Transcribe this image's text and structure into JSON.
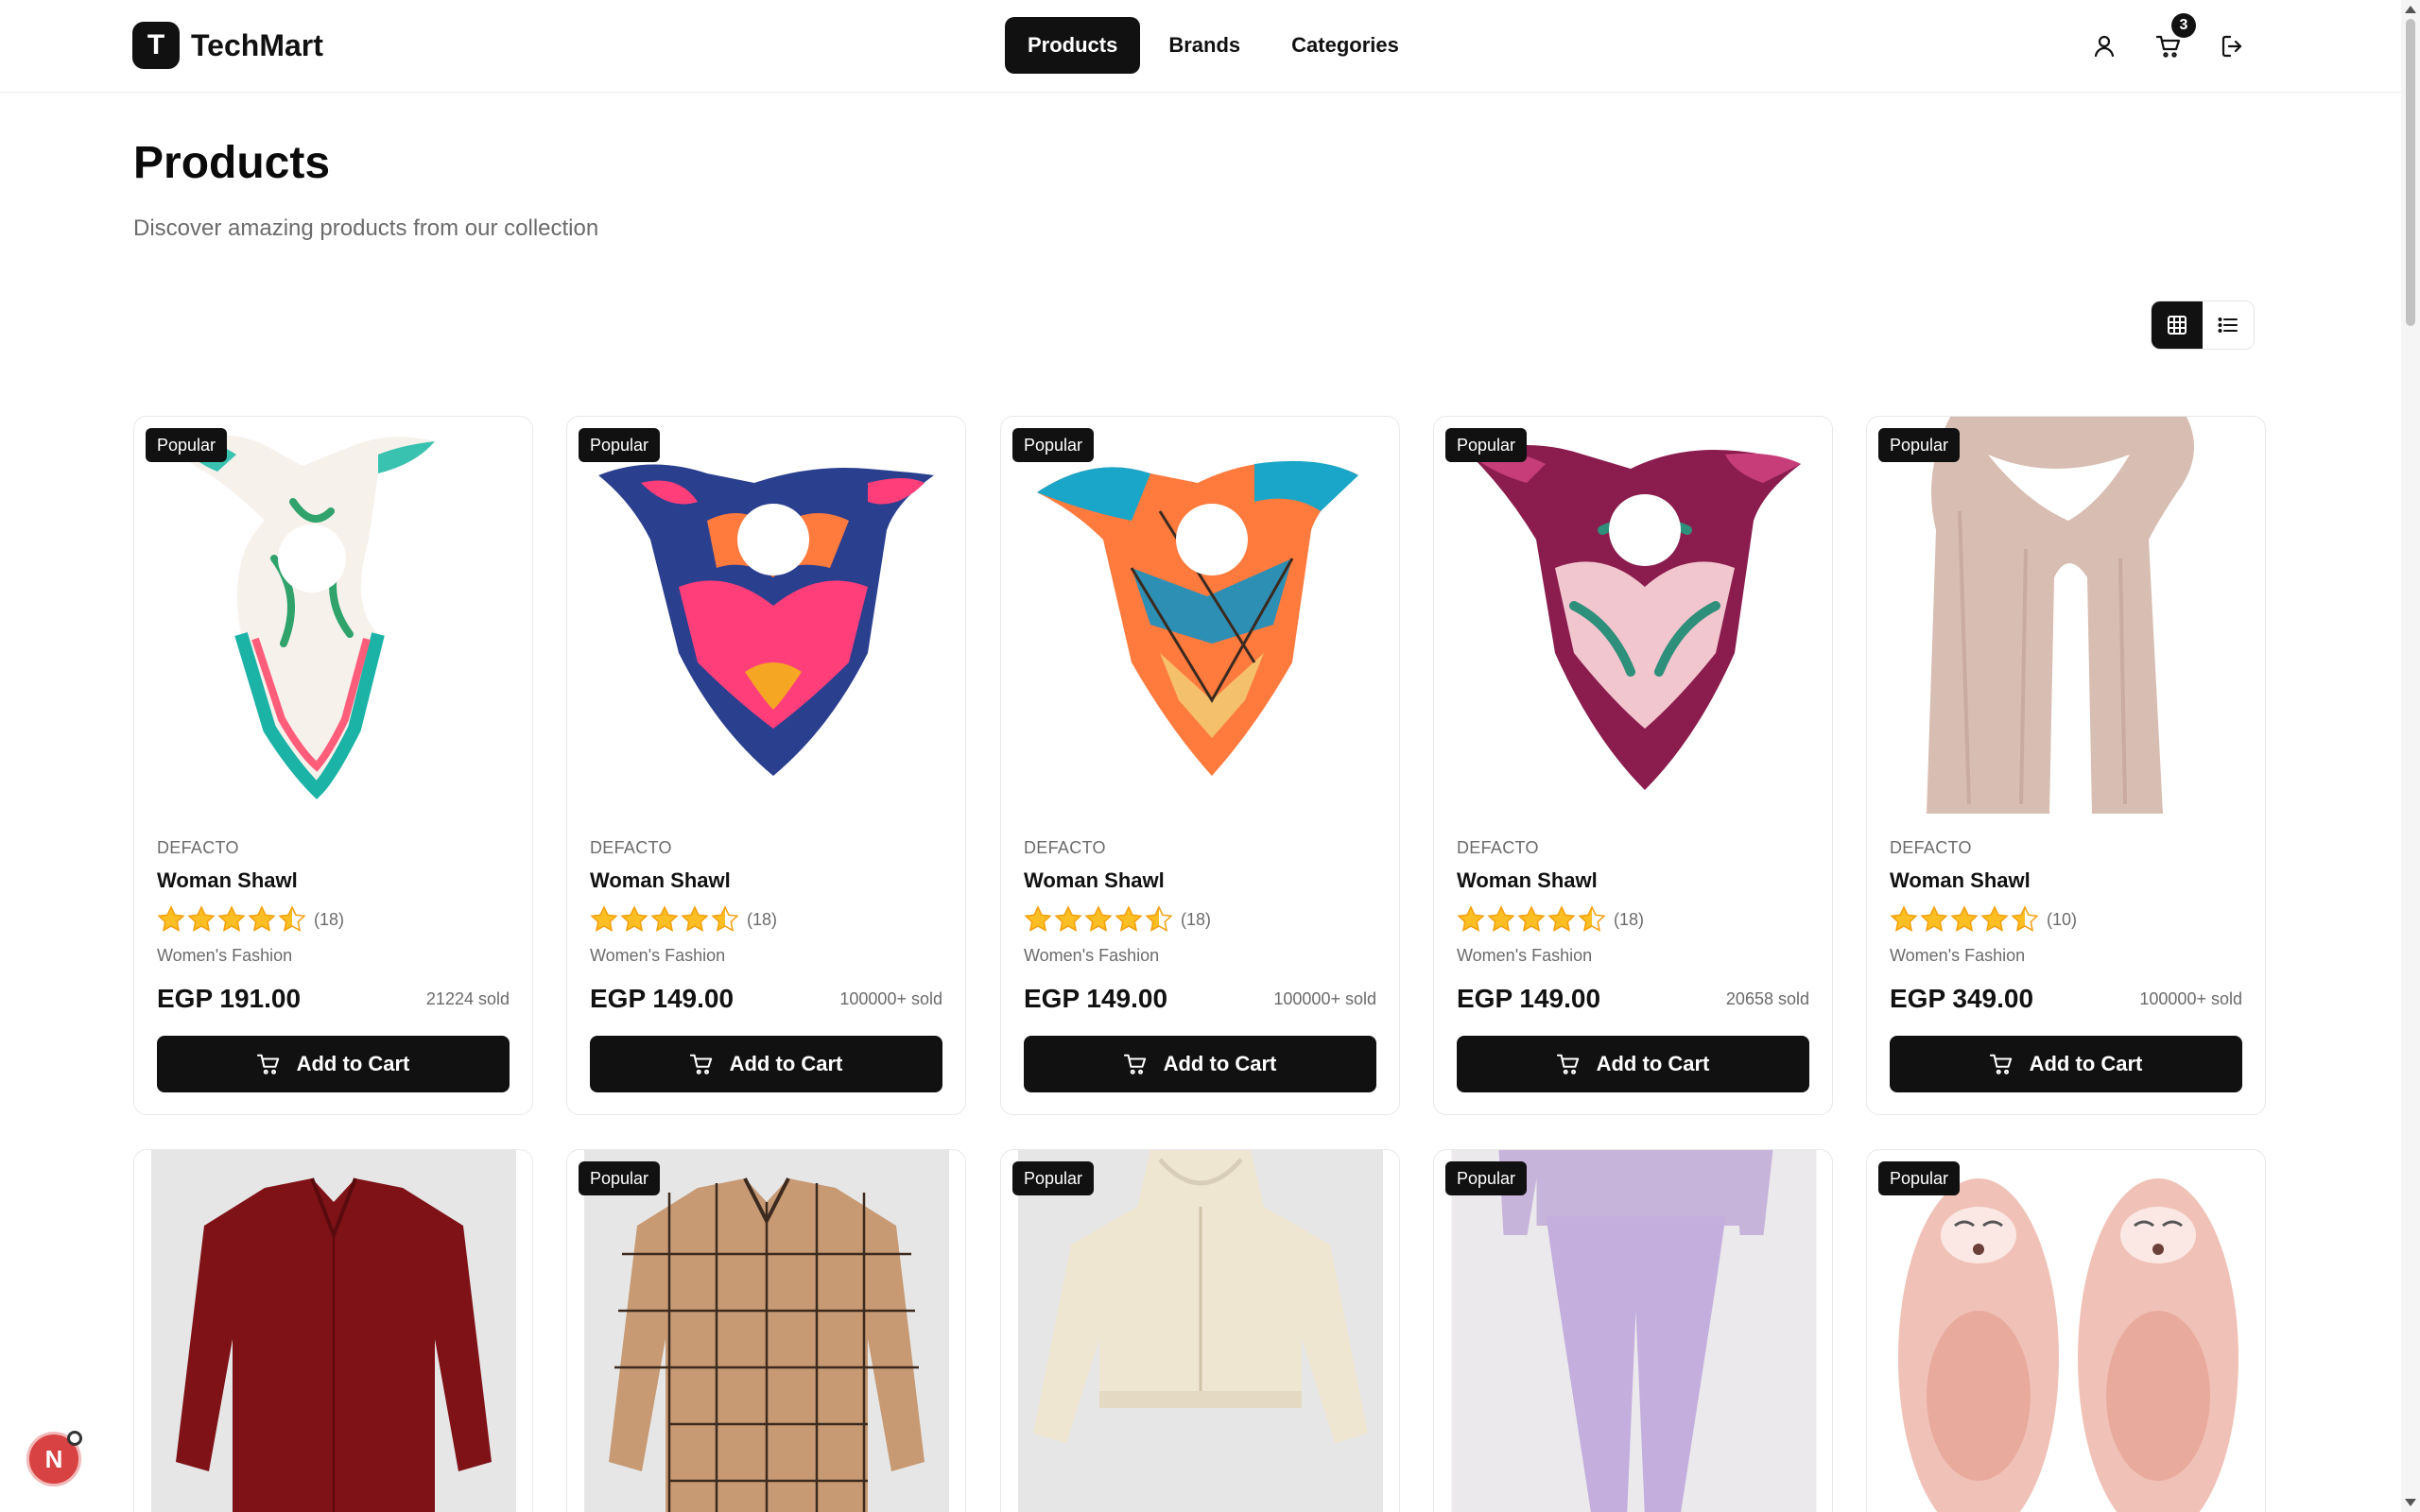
{
  "header": {
    "logo_letter": "T",
    "logo_text": "TechMart",
    "nav": [
      "Products",
      "Brands",
      "Categories"
    ],
    "cart_count": "3"
  },
  "page": {
    "title": "Products",
    "subtitle": "Discover amazing products from our collection"
  },
  "colors": {
    "primary": "#111111",
    "star": "#fbbf24",
    "muted_text": "#6b6b6b",
    "floating_button": "#d94242"
  },
  "products": [
    {
      "badge": "Popular",
      "brand": "DEFACTO",
      "name": "Woman Shawl",
      "rating": 4.5,
      "reviews": "(18)",
      "category": "Women's Fashion",
      "price": "EGP 191.00",
      "sold": "21224 sold",
      "button": "Add to Cart",
      "image": "white-green-floral-scarf"
    },
    {
      "badge": "Popular",
      "brand": "DEFACTO",
      "name": "Woman Shawl",
      "rating": 4.5,
      "reviews": "(18)",
      "category": "Women's Fashion",
      "price": "EGP 149.00",
      "sold": "100000+ sold",
      "button": "Add to Cart",
      "image": "pink-navy-orange-scarf"
    },
    {
      "badge": "Popular",
      "brand": "DEFACTO",
      "name": "Woman Shawl",
      "rating": 4.5,
      "reviews": "(18)",
      "category": "Women's Fashion",
      "price": "EGP 149.00",
      "sold": "100000+ sold",
      "button": "Add to Cart",
      "image": "teal-orange-geometric-scarf"
    },
    {
      "badge": "Popular",
      "brand": "DEFACTO",
      "name": "Woman Shawl",
      "rating": 4.5,
      "reviews": "(18)",
      "category": "Women's Fashion",
      "price": "EGP 149.00",
      "sold": "20658 sold",
      "button": "Add to Cart",
      "image": "burgundy-pink-leaf-scarf"
    },
    {
      "badge": "Popular",
      "brand": "DEFACTO",
      "name": "Woman Shawl",
      "rating": 4.5,
      "reviews": "(10)",
      "category": "Women's Fashion",
      "price": "EGP 349.00",
      "sold": "100000+ sold",
      "button": "Add to Cart",
      "image": "beige-long-scarf"
    },
    {
      "badge": "",
      "image": "burgundy-blouse"
    },
    {
      "badge": "Popular",
      "image": "brown-plaid-shirt"
    },
    {
      "badge": "Popular",
      "image": "cream-zip-hoodie"
    },
    {
      "badge": "Popular",
      "image": "lilac-sweatpants"
    },
    {
      "badge": "Popular",
      "image": "pink-fluffy-slippers"
    }
  ],
  "floating_button": {
    "label": "N"
  }
}
